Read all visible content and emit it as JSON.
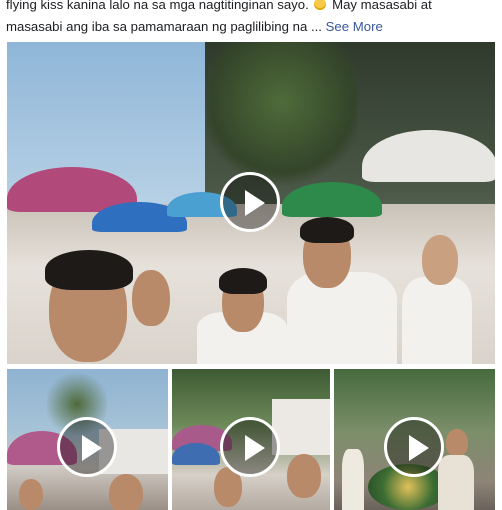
{
  "post": {
    "caption_line1": "flying kiss kanina lalo na sa mga nagtitinginan sayo.",
    "caption_line1b": "May masasabi at",
    "caption_line2": "masasabi ang iba sa pamamaraan ng paglilibing na ...",
    "see_more_label": "See More",
    "emoji": "grinning-face-emoji"
  },
  "videos": [
    {
      "id": "main",
      "icon": "play-icon"
    },
    {
      "id": "thumb-1",
      "icon": "play-icon"
    },
    {
      "id": "thumb-2",
      "icon": "play-icon"
    },
    {
      "id": "thumb-3",
      "icon": "play-icon"
    }
  ],
  "colors": {
    "link": "#385898",
    "text": "#1c1e21",
    "play_ring": "#ffffff"
  }
}
